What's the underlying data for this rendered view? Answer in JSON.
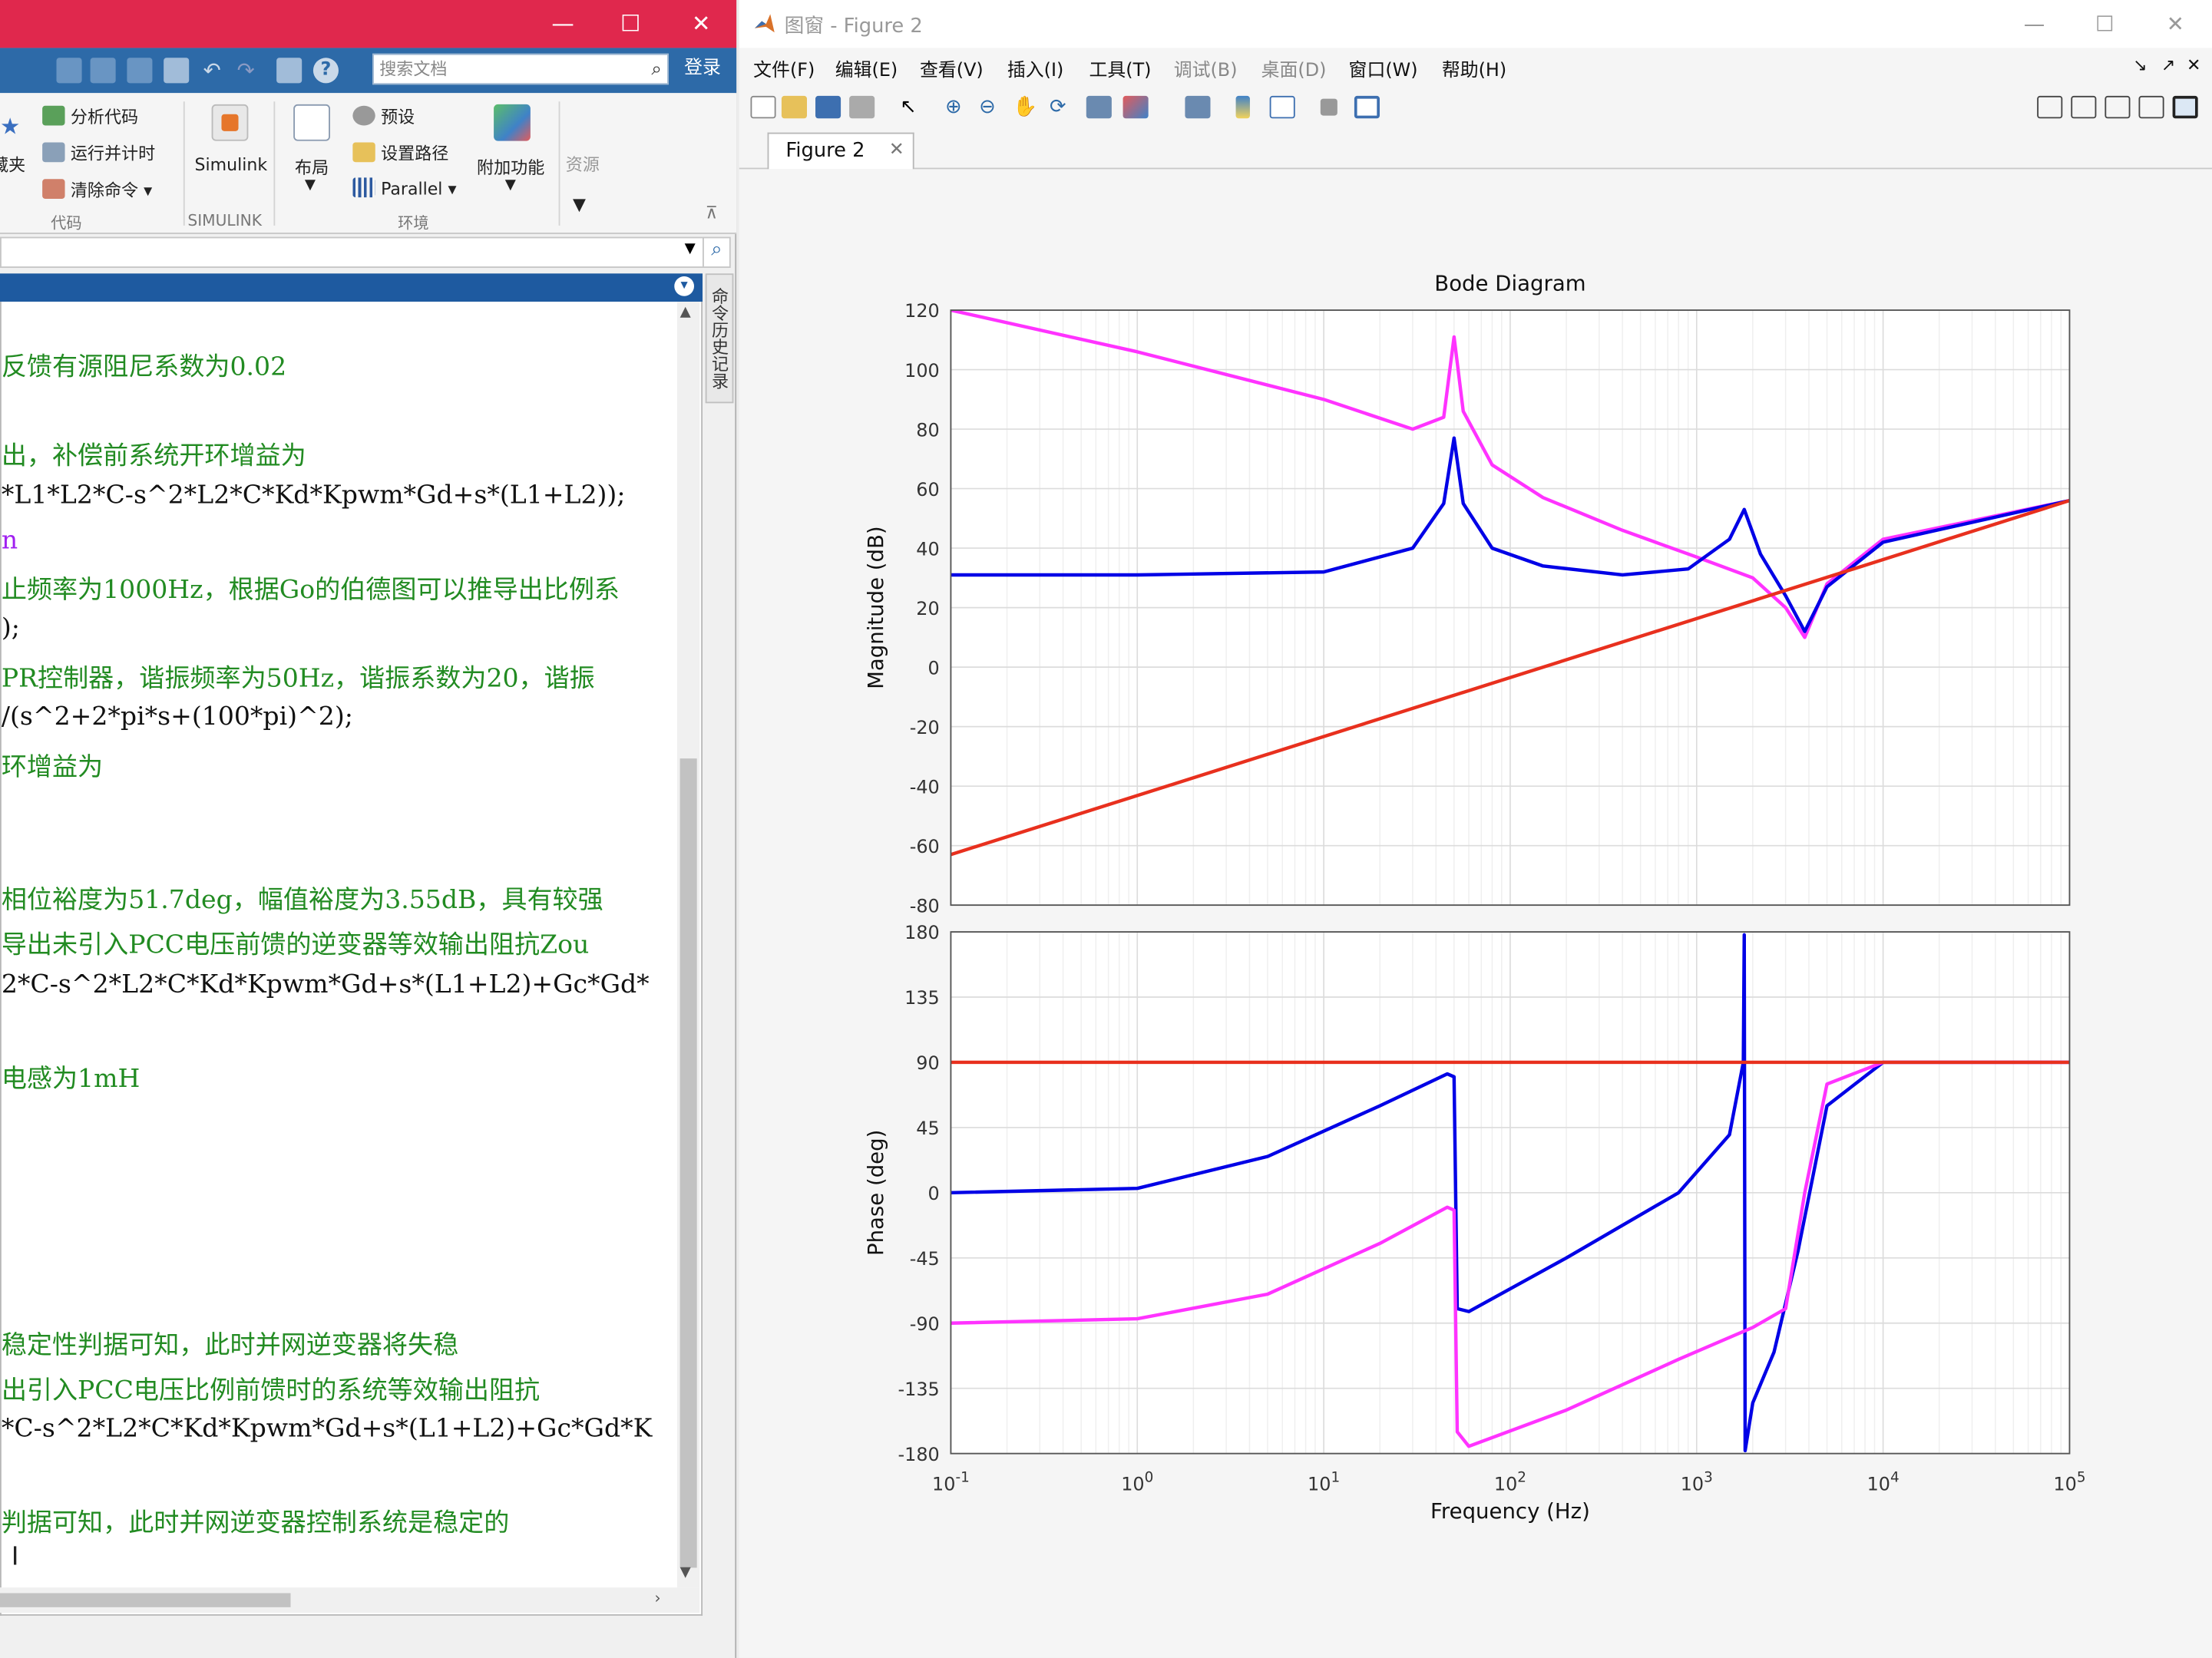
{
  "main_window": {
    "toolbar": {
      "search_placeholder": "搜索文档",
      "login_label": "登录"
    },
    "ribbon": {
      "partial_left_label": "收藏夹",
      "code_items": [
        "分析代码",
        "运行并计时",
        "清除命令"
      ],
      "code_section": "代码",
      "simulink_label": "Simulink",
      "simulink_section": "SIMULINK",
      "layout_label": "布局",
      "env_items": [
        "预设",
        "设置路径",
        "Parallel"
      ],
      "env_section": "环境",
      "addons_label": "附加功能",
      "resources_label": "资源"
    },
    "history_tab": "命令历史记录",
    "command_lines": [
      {
        "text": "反馈有源阻尼系数为0.02",
        "color": "green"
      },
      {
        "text": "出，补偿前系统开环增益为",
        "color": "green"
      },
      {
        "text": "*L1*L2*C-s^2*L2*C*Kd*Kpwm*Gd+s*(L1+L2));",
        "color": "black"
      },
      {
        "text": "n",
        "color": "purple"
      },
      {
        "text": "止频率为1000Hz，根据Go的伯德图可以推导出比例系",
        "color": "green"
      },
      {
        "text": ");",
        "color": "black"
      },
      {
        "text": "PR控制器，谐振频率为50Hz，谐振系数为20，谐振",
        "color": "green"
      },
      {
        "text": "/(s^2+2*pi*s+(100*pi)^2);",
        "color": "black"
      },
      {
        "text": "环增益为",
        "color": "green"
      },
      {
        "text": "相位裕度为51.7deg，幅值裕度为3.55dB，具有较强",
        "color": "green"
      },
      {
        "text": "导出未引入PCC电压前馈的逆变器等效输出阻抗Zou",
        "color": "green"
      },
      {
        "text": "2*C-s^2*L2*C*Kd*Kpwm*Gd+s*(L1+L2)+Gc*Gd*",
        "color": "black"
      },
      {
        "text": "电感为1mH",
        "color": "green"
      },
      {
        "text": "稳定性判据可知，此时并网逆变器将失稳",
        "color": "green"
      },
      {
        "text": "出引入PCC电压比例前馈时的系统等效输出阻抗",
        "color": "green"
      },
      {
        "text": "*C-s^2*L2*C*Kd*Kpwm*Gd+s*(L1+L2)+Gc*Gd*K",
        "color": "black"
      },
      {
        "text": "判据可知，此时并网逆变器控制系统是稳定的",
        "color": "green"
      }
    ]
  },
  "figure_window": {
    "title": "图窗 - Figure 2",
    "menus": [
      "文件(F)",
      "编辑(E)",
      "查看(V)",
      "插入(I)",
      "工具(T)",
      "调试(B)",
      "桌面(D)",
      "窗口(W)",
      "帮助(H)"
    ],
    "tab_label": "Figure 2"
  },
  "chart_data": {
    "type": "line",
    "title": "Bode Diagram",
    "xlabel": "Frequency  (Hz)",
    "xscale": "log",
    "xlim": [
      0.1,
      100000
    ],
    "x_tick_labels": [
      "10^-1",
      "10^0",
      "10^1",
      "10^2",
      "10^3",
      "10^4",
      "10^5"
    ],
    "grid": true,
    "legend": "none",
    "subplots": [
      {
        "name": "magnitude",
        "ylabel": "Magnitude (dB)",
        "ylim": [
          -80,
          120
        ],
        "yticks": [
          -80,
          -60,
          -40,
          -20,
          0,
          20,
          40,
          60,
          80,
          100,
          120
        ],
        "series": [
          {
            "color": "#ff33ff",
            "x": [
              0.1,
              1,
              10,
              30,
              44,
              50,
              56,
              80,
              150,
              400,
              1000,
              2000,
              3000,
              3800,
              5000,
              10000,
              100000
            ],
            "y": [
              120,
              106,
              90,
              80,
              84,
              111,
              86,
              68,
              57,
              46,
              37,
              30,
              20,
              10,
              28,
              43,
              56
            ]
          },
          {
            "color": "#0000e6",
            "x": [
              0.1,
              1,
              10,
              30,
              44,
              50,
              56,
              80,
              150,
              400,
              900,
              1500,
              1800,
              2200,
              3000,
              3800,
              5000,
              10000,
              100000
            ],
            "y": [
              31,
              31,
              32,
              40,
              55,
              77,
              55,
              40,
              34,
              31,
              33,
              43,
              53,
              38,
              24,
              12,
              27,
              42,
              56
            ]
          },
          {
            "color": "#e8301e",
            "x": [
              0.1,
              100000
            ],
            "y": [
              -63,
              56
            ]
          }
        ]
      },
      {
        "name": "phase",
        "ylabel": "Phase (deg)",
        "ylim": [
          -180,
          180
        ],
        "yticks": [
          -180,
          -135,
          -90,
          -45,
          0,
          45,
          90,
          135,
          180
        ],
        "series": [
          {
            "color": "#0000e6",
            "x": [
              0.1,
              1,
              5,
              20,
              46,
              50,
              52,
              60,
              200,
              800,
              1500,
              1780,
              1800,
              1820,
              2000,
              2600,
              3500,
              5000,
              10000,
              100000
            ],
            "y": [
              0,
              3,
              25,
              60,
              82,
              80,
              -80,
              -82,
              -45,
              0,
              40,
              90,
              178,
              -178,
              -145,
              -110,
              -40,
              60,
              90,
              90
            ]
          },
          {
            "color": "#ff33ff",
            "x": [
              0.1,
              1,
              5,
              20,
              46,
              50,
              52,
              60,
              200,
              800,
              2000,
              3000,
              3800,
              5000,
              10000,
              100000
            ],
            "y": [
              -90,
              -87,
              -70,
              -35,
              -10,
              -12,
              -165,
              -175,
              -150,
              -115,
              -93,
              -80,
              0,
              75,
              90,
              90
            ]
          },
          {
            "color": "#e8301e",
            "x": [
              0.1,
              100000
            ],
            "y": [
              90,
              90
            ]
          }
        ]
      }
    ]
  }
}
